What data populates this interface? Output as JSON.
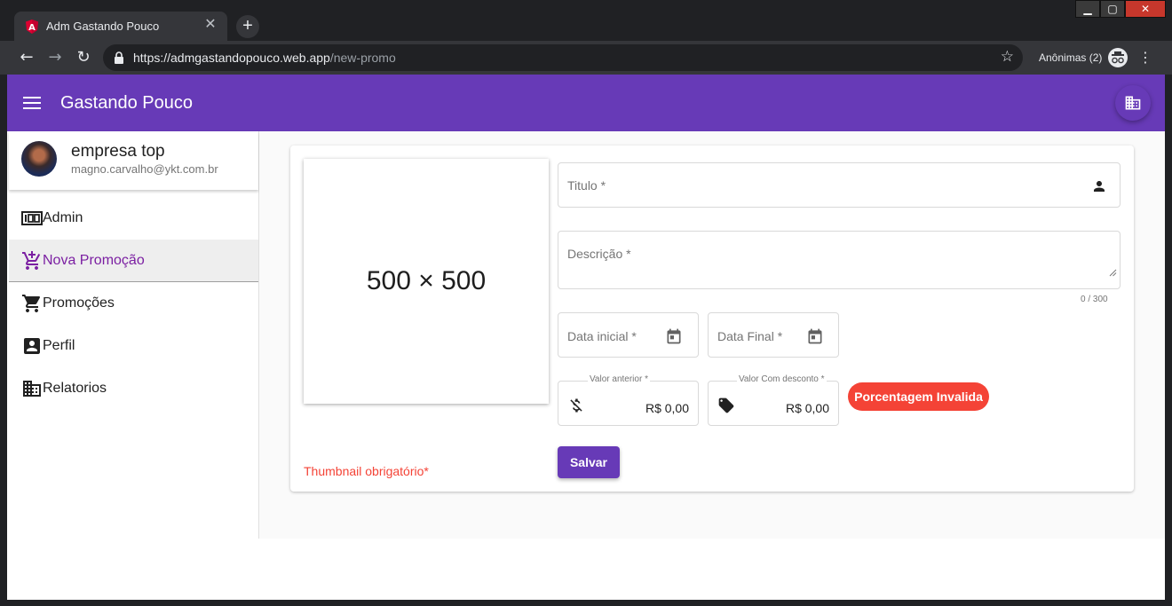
{
  "browser": {
    "tab_title": "Adm Gastando Pouco",
    "tab_close": "✕",
    "new_tab": "+",
    "url_host": "https://admgastandopouco.web.app",
    "url_path": "/new-promo",
    "incognito_label": "Anônimas (2)",
    "icons": [
      "angular-favicon-icon",
      "back-arrow-icon",
      "forward-arrow-icon",
      "reload-icon",
      "lock-icon",
      "bookmark-star-icon",
      "incognito-icon",
      "kebab-menu-icon"
    ]
  },
  "appbar": {
    "title": "Gastando Pouco",
    "accent_color": "#673ab7"
  },
  "profile": {
    "name": "empresa top",
    "email": "magno.carvalho@ykt.com.br"
  },
  "sidebar": {
    "items": [
      {
        "label": "Admin",
        "icon": "admin-100-icon"
      },
      {
        "label": "Nova Promoção",
        "icon": "add-shopping-cart-icon",
        "active": true
      },
      {
        "label": "Promoções",
        "icon": "shopping-cart-icon"
      },
      {
        "label": "Perfil",
        "icon": "account-box-icon"
      },
      {
        "label": "Relatorios",
        "icon": "business-icon"
      }
    ]
  },
  "form": {
    "thumbnail_placeholder": "500 × 500",
    "thumbnail_error": "Thumbnail obrigatório*",
    "titulo_label": "Titulo *",
    "descricao_label": "Descrição *",
    "descricao_counter": "0 / 300",
    "data_inicial_label": "Data inicial *",
    "data_final_label": "Data Final *",
    "valor_anterior_label": "Valor anterior *",
    "valor_anterior_value": "R$ 0,00",
    "valor_desconto_label": "Valor Com desconto *",
    "valor_desconto_value": "R$ 0,00",
    "percentage_chip": "Porcentagem Invalida",
    "error_color": "#f44336",
    "save_label": "Salvar"
  }
}
